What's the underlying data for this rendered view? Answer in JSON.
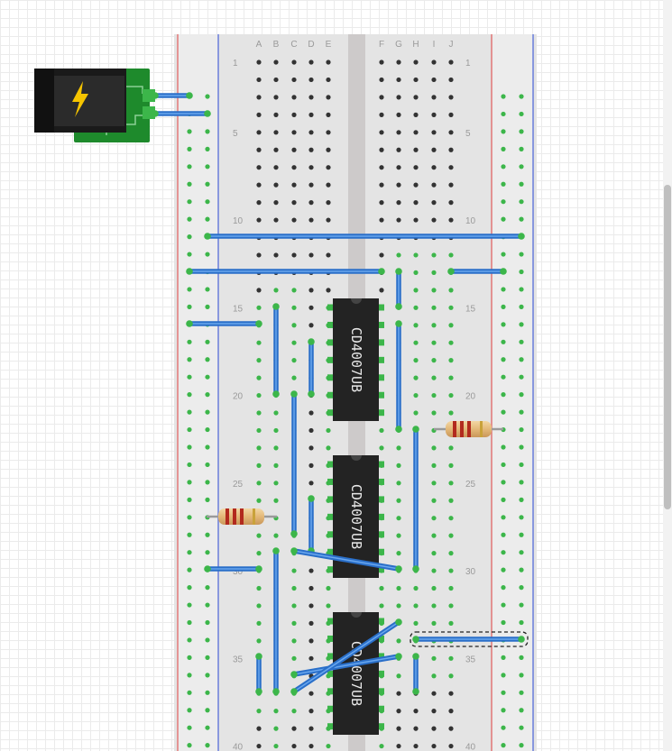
{
  "breadboard": {
    "column_labels_left": [
      "A",
      "B",
      "C",
      "D",
      "E"
    ],
    "column_labels_right": [
      "F",
      "G",
      "H",
      "I",
      "J"
    ],
    "row_numbers": [
      "1",
      "5",
      "10",
      "15",
      "20",
      "25",
      "30",
      "35",
      "40"
    ]
  },
  "chips": [
    {
      "label": "CD4007UB"
    },
    {
      "label": "CD4007UB"
    },
    {
      "label": "CD4007UB"
    }
  ],
  "colors": {
    "wire": "#2a6fc9",
    "wire_highlight": "#6aa7ee",
    "rail_red": "#e05a5a",
    "rail_blue": "#4a63d8",
    "hole": "#333333",
    "hole_connected": "#3cb64a",
    "chip_body": "#232323",
    "pcb_green": "#1e8a2c",
    "bolt": "#f5c400"
  },
  "icons": {
    "power_jack": "lightning-bolt-icon"
  },
  "scrollbar": {
    "thumb_fraction": 0.43
  }
}
